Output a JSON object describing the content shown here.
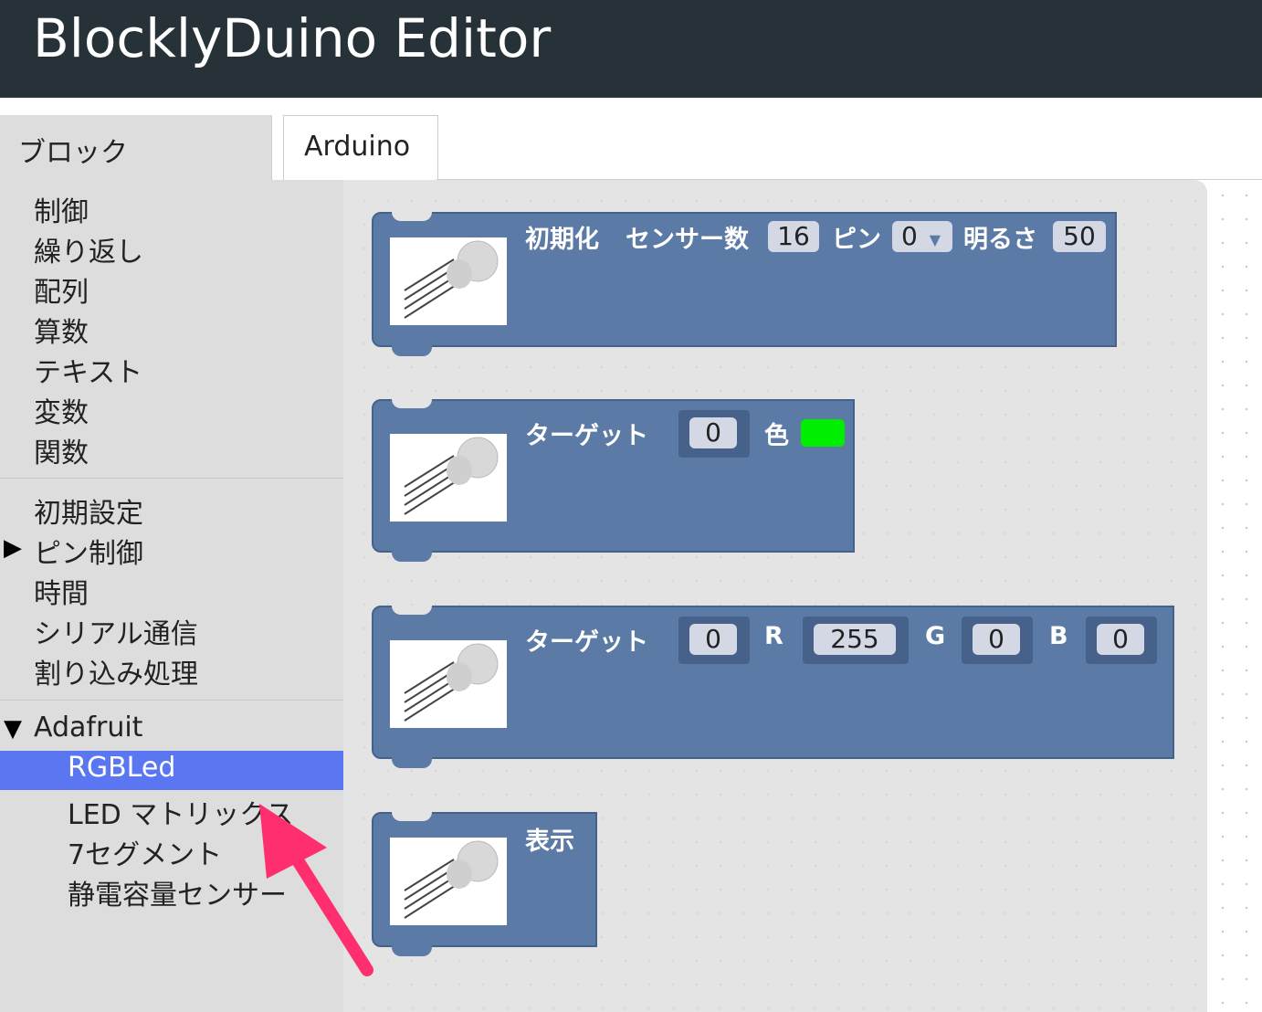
{
  "app": {
    "title": "BlocklyDuino Editor"
  },
  "tabs": {
    "blocks": "ブロック",
    "arduino": "Arduino"
  },
  "toolbox": {
    "group1": [
      "制御",
      "繰り返し",
      "配列",
      "算数",
      "テキスト",
      "変数",
      "関数"
    ],
    "group2": [
      {
        "label": "初期設定",
        "marker": ""
      },
      {
        "label": "ピン制御",
        "marker": "▶"
      },
      {
        "label": "時間",
        "marker": ""
      },
      {
        "label": "シリアル通信",
        "marker": ""
      },
      {
        "label": "割り込み処理",
        "marker": ""
      }
    ],
    "adafruit": {
      "marker": "▼",
      "label": "Adafruit",
      "items": [
        "RGBLed",
        "LED マトリックス",
        "7セグメント",
        "静電容量センサー"
      ],
      "selected": "RGBLed"
    }
  },
  "blocks": {
    "init": {
      "label1": "初期化",
      "label2": "センサー数",
      "count": "16",
      "pin_label": "ピン",
      "pin": "0",
      "bright_label": "明るさ",
      "bright": "50"
    },
    "color": {
      "target_label": "ターゲット",
      "target": "0",
      "color_label": "色",
      "color": "#00ee00"
    },
    "rgb": {
      "target_label": "ターゲット",
      "target": "0",
      "r_label": "R",
      "r": "255",
      "g_label": "G",
      "g": "0",
      "b_label": "B",
      "b": "0"
    },
    "show": {
      "label": "表示"
    }
  },
  "colors": {
    "header": "#263238",
    "block": "#5b7aa6",
    "selected": "#5a76f0",
    "arrow": "#ff2e6e"
  }
}
